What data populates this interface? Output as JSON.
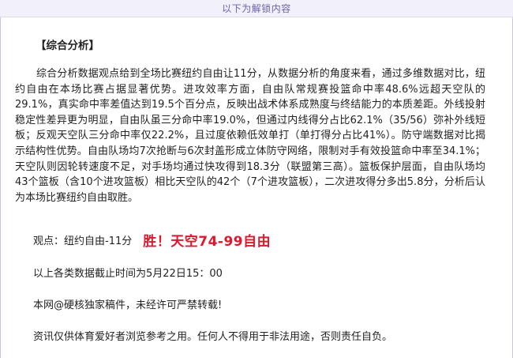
{
  "banner": {
    "text": "以下为解锁内容"
  },
  "article": {
    "section_title": "【综合分析】",
    "analysis": "综合分析数据观点给到全场比赛纽约自由让11分，从数据分析的角度来看，通过多维数据对比，纽约自由在本场比赛占据显著优势。进攻效率方面，自由队常规赛投篮命中率48.6%远超天空队的29.1%，真实命中率差值达到19.5个百分点，反映出战术体系成熟度与终结能力的本质差距。外线投射稳定性差异更为明显，自由队虽三分命中率19.0%，但通过内线得分占比62.1%（35/56）弥补外线短板；反观天空队三分命中率仅22.2%，且过度依赖低效单打（单打得分占比41%）。防守端数据对比揭示结构性优势。自由队场均7次抢断与6次封盖形成立体防守网络，限制对手有效投篮命中率至34.1%；天空队则因轮转速度不足，对手场均通过快攻得到18.3分（联盟第三高）。篮板保护层面，自由队场均43个篮板（含10个进攻篮板）相比天空队的42个（7个进攻篮板），二次进攻得分多出5.8分，分析后认为本场比赛纽约自由取胜。",
    "viewpoint": "观点：纽约自由-11分",
    "result": "胜！天空74-99自由",
    "deadline": "以上各类数据截止时间为5月22日15：00",
    "copyright": "本网@硬核独家稿件，未经许可严禁转载!",
    "disclaimer": "资讯仅供体育爱好者浏览参考之用。任何人不得用于非法用途，否则责任自负。"
  },
  "colors": {
    "banner_bg": "#f1f0fb",
    "banner_text": "#6e63a8",
    "result_red": "#e0182e",
    "frame_border": "#c9c3ea"
  }
}
